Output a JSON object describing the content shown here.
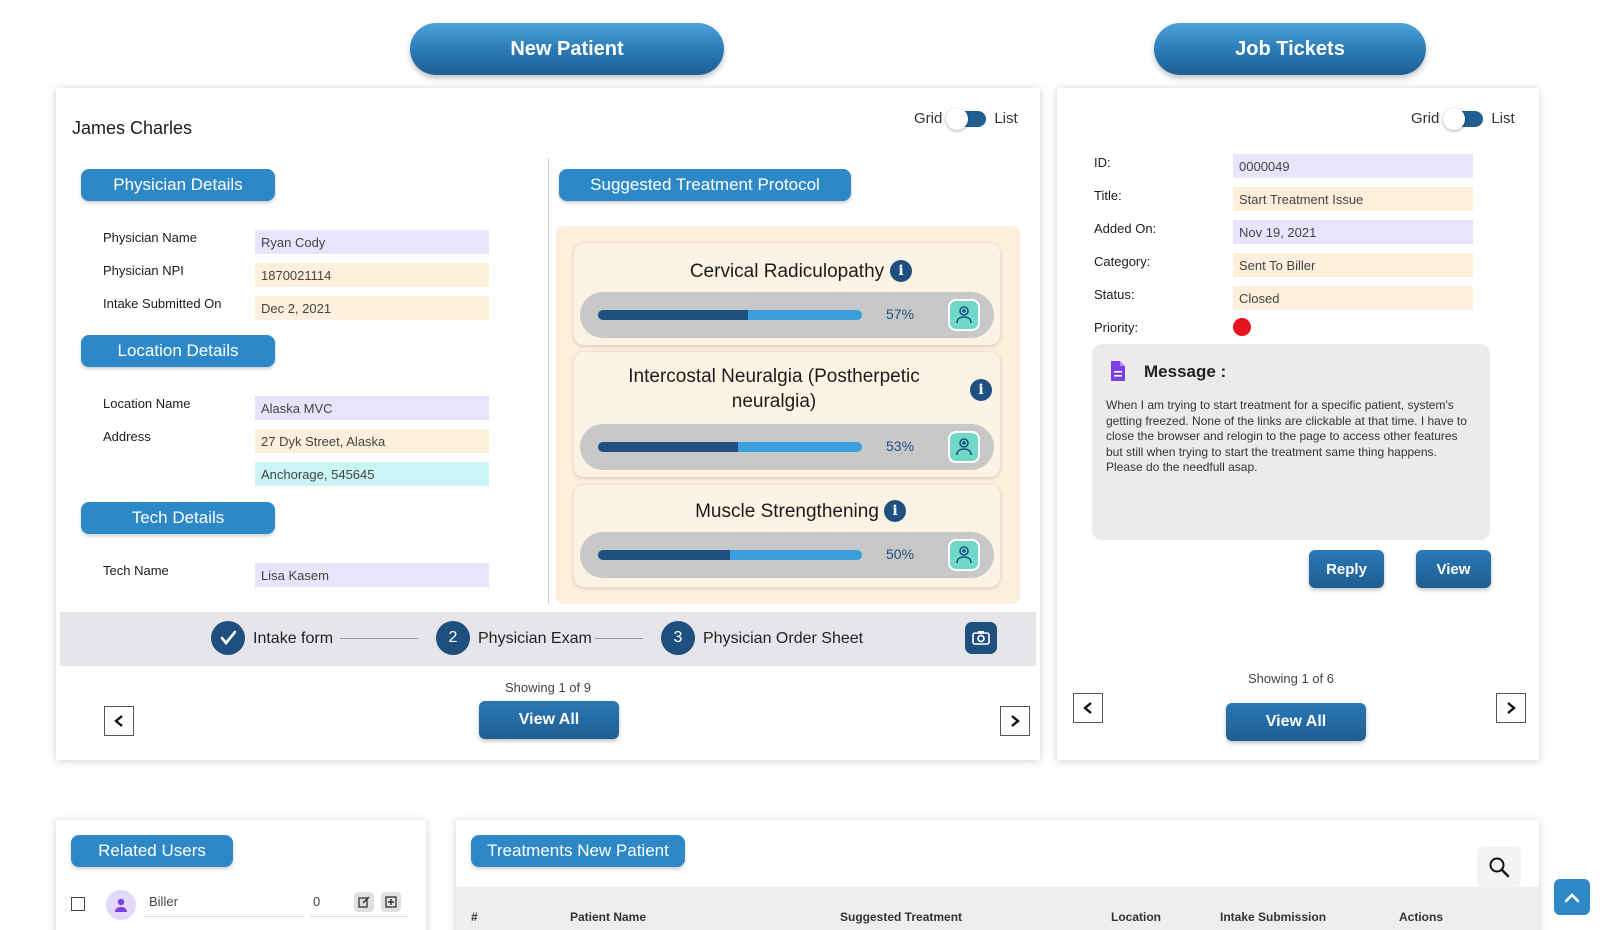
{
  "header": {
    "new_patient_label": "New Patient",
    "job_tickets_label": "Job Tickets"
  },
  "patient": {
    "name": "James Charles",
    "view_toggle": {
      "grid_label": "Grid",
      "list_label": "List"
    },
    "physician_section": "Physician Details",
    "physician_fields": [
      {
        "label": "Physician Name",
        "value": "Ryan Cody"
      },
      {
        "label": "Physician NPI",
        "value": "1870021114"
      },
      {
        "label": "Intake Submitted On",
        "value": "Dec 2, 2021"
      }
    ],
    "location_section": "Location Details",
    "location_fields": [
      {
        "label": "Location Name",
        "value": "Alaska MVC"
      },
      {
        "label": "Address",
        "value": "27 Dyk Street, Alaska"
      },
      {
        "label": "",
        "value": "Anchorage, 545645"
      }
    ],
    "tech_section": "Tech Details",
    "tech_fields": [
      {
        "label": "Tech Name",
        "value": "Lisa Kasem"
      }
    ],
    "protocol_section": "Suggested Treatment Protocol",
    "treatments": [
      {
        "title": "Cervical Radiculopathy",
        "percent": 57,
        "percent_label": "57%"
      },
      {
        "title": "Intercostal Neuralgia (Postherpetic neuralgia)",
        "percent": 53,
        "percent_label": "53%"
      },
      {
        "title": "Muscle Strengthening",
        "percent": 50,
        "percent_label": "50%"
      }
    ],
    "steps": [
      {
        "number": "",
        "label": "Intake form",
        "done": true
      },
      {
        "number": "2",
        "label": "Physician Exam",
        "done": false
      },
      {
        "number": "3",
        "label": "Physician Order Sheet",
        "done": false
      }
    ],
    "showing": "Showing 1 of 9",
    "view_all_label": "View All"
  },
  "ticket": {
    "view_toggle": {
      "grid_label": "Grid",
      "list_label": "List"
    },
    "fields": [
      {
        "label": "ID:",
        "value": "0000049"
      },
      {
        "label": "Title:",
        "value": "Start Treatment Issue"
      },
      {
        "label": "Added On:",
        "value": "Nov 19, 2021"
      },
      {
        "label": "Category:",
        "value": "Sent To Biller"
      },
      {
        "label": "Status:",
        "value": "Closed"
      }
    ],
    "priority_label": "Priority:",
    "priority_color": "#e8141b",
    "message_title": "Message :",
    "message_body": "When I am trying to start treatment for a specific patient, system's getting freezed. None of the links are clickable at that time. I have to close the browser and relogin to the page to access other features but still when trying to start the treatment same thing happens. Please do the needfull asap.",
    "reply_label": "Reply",
    "view_label": "View",
    "showing": "Showing 1 of 6",
    "view_all_label": "View All"
  },
  "related_users": {
    "title": "Related Users",
    "rows": [
      {
        "name": "Biller",
        "count": "0"
      }
    ]
  },
  "treatments_table": {
    "title": "Treatments New Patient",
    "columns": [
      "#",
      "Patient Name",
      "Suggested Treatment",
      "Location",
      "Intake Submission",
      "Actions"
    ]
  },
  "colors": {
    "primary": "#1f5f92",
    "accent": "#2d88c8",
    "lavender": "#e9e3fb",
    "peach": "#fdefdc",
    "cyan": "#c9f5f5"
  }
}
